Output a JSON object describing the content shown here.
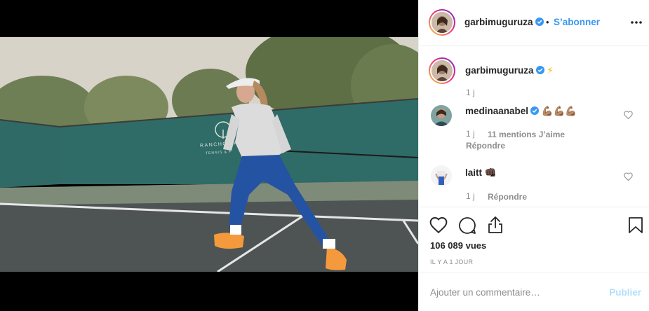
{
  "post": {
    "author": "garbimuguruza",
    "follow_label": "S’abonner",
    "separator": "•",
    "caption_emoji": "⚡",
    "caption_time": "1 j",
    "views": "106 089 vues",
    "date": "IL Y A 1 JOUR"
  },
  "video_overlay": {
    "sign_line1": "RANCHO VA",
    "sign_line2": "TENNIS & F"
  },
  "comments": [
    {
      "user": "medinaanabel",
      "verified": true,
      "text": "💪🏽💪🏽💪🏽",
      "time": "1 j",
      "likes": "11 mentions J’aime",
      "reply": "Répondre"
    },
    {
      "user": "laitt",
      "verified": false,
      "text": "👊🏿",
      "time": "1 j",
      "reply": "Répondre"
    }
  ],
  "add_comment": {
    "placeholder": "Ajouter un commentaire…",
    "publish": "Publier"
  },
  "colors": {
    "link": "#3897f0",
    "muted": "#8e8e8e",
    "publish_disabled": "#b2dffc",
    "text": "#262626"
  },
  "icons": [
    "verified-badge-icon",
    "more-options-icon",
    "heart-icon",
    "comment-icon",
    "share-icon",
    "bookmark-icon"
  ]
}
